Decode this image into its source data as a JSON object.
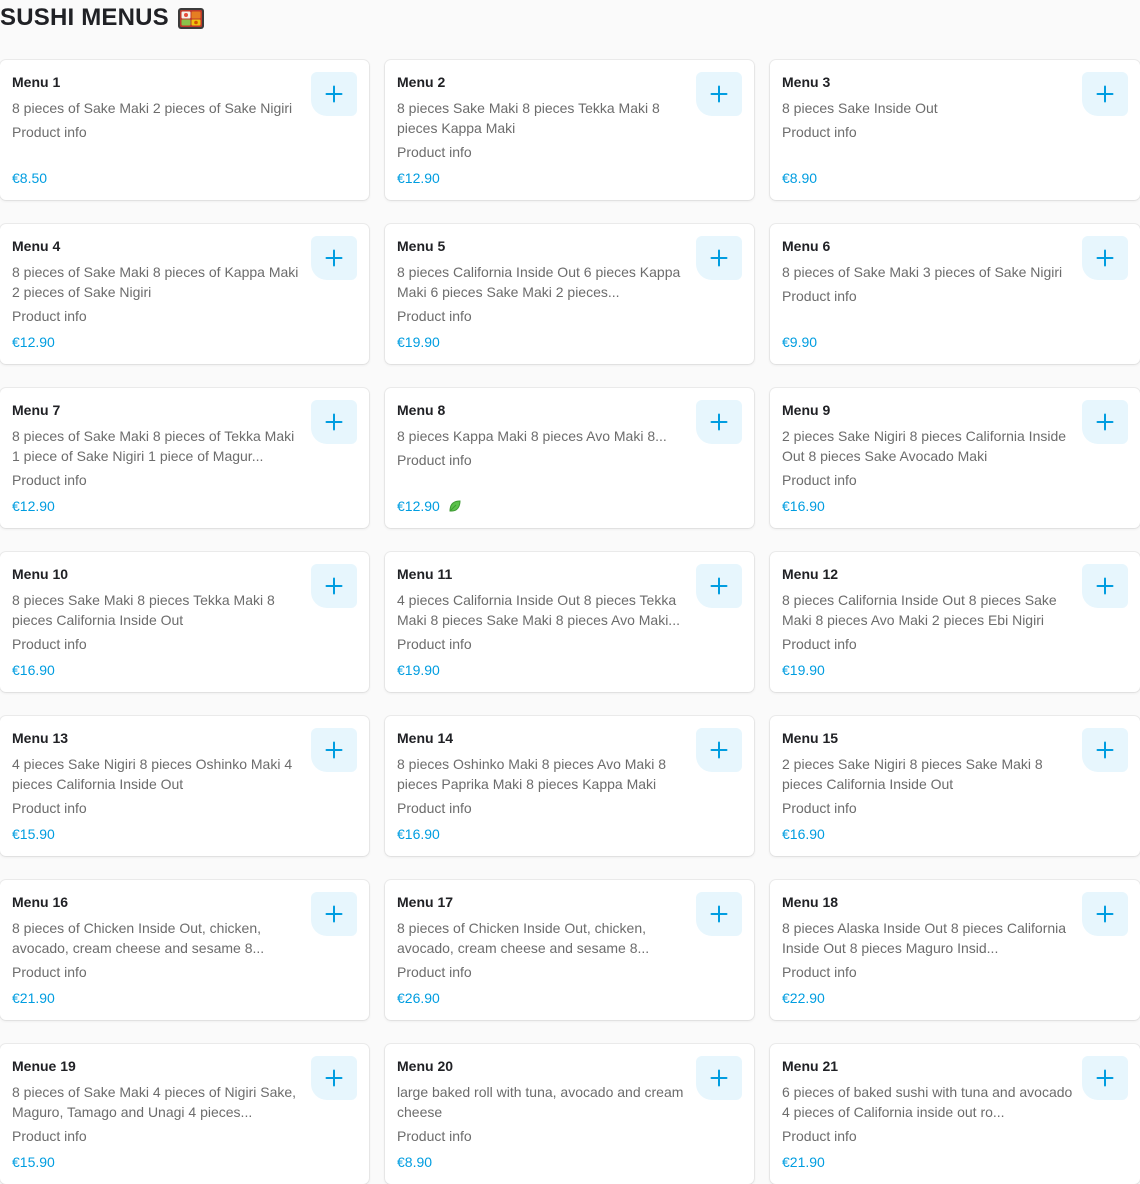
{
  "section": {
    "title": "SUSHI MENUS",
    "title_icon": "bento-box-icon"
  },
  "colors": {
    "accent": "#009de0",
    "add_bg": "#e7f6fd",
    "veg": "#5ac24a"
  },
  "items": [
    {
      "name": "Menu 1",
      "desc": "8 pieces of Sake Maki 2 pieces of Sake Nigiri",
      "info": "Product info",
      "price": "€8.50"
    },
    {
      "name": "Menu 2",
      "desc": "8 pieces Sake Maki 8 pieces Tekka Maki 8 pieces Kappa Maki",
      "info": "Product info",
      "price": "€12.90"
    },
    {
      "name": "Menu 3",
      "desc": "8 pieces Sake Inside Out",
      "info": "Product info",
      "price": "€8.90"
    },
    {
      "name": "Menu 4",
      "desc": "8 pieces of Sake Maki 8 pieces of Kappa Maki 2 pieces of Sake Nigiri",
      "info": "Product info",
      "price": "€12.90"
    },
    {
      "name": "Menu 5",
      "desc": "8 pieces California Inside Out 6 pieces Kappa Maki 6 pieces Sake Maki 2 pieces...",
      "info": "Product info",
      "price": "€19.90"
    },
    {
      "name": "Menu 6",
      "desc": "8 pieces of Sake Maki 3 pieces of Sake Nigiri",
      "info": "Product info",
      "price": "€9.90"
    },
    {
      "name": "Menu 7",
      "desc": "8 pieces of Sake Maki 8 pieces of Tekka Maki 1 piece of Sake Nigiri 1 piece of Magur...",
      "info": "Product info",
      "price": "€12.90"
    },
    {
      "name": "Menu 8",
      "desc": "8 pieces Kappa Maki 8 pieces Avo Maki 8...",
      "info": "Product info",
      "price": "€12.90",
      "vegetarian": true
    },
    {
      "name": "Menu 9",
      "desc": "2 pieces Sake Nigiri 8 pieces California Inside Out 8 pieces Sake Avocado Maki",
      "info": "Product info",
      "price": "€16.90"
    },
    {
      "name": "Menu 10",
      "desc": "8 pieces Sake Maki 8 pieces Tekka Maki 8 pieces California Inside Out",
      "info": "Product info",
      "price": "€16.90"
    },
    {
      "name": "Menu 11",
      "desc": "4 pieces California Inside Out 8 pieces Tekka Maki 8 pieces Sake Maki 8 pieces Avo Maki...",
      "info": "Product info",
      "price": "€19.90"
    },
    {
      "name": "Menu 12",
      "desc": "8 pieces California Inside Out 8 pieces Sake Maki 8 pieces Avo Maki 2 pieces Ebi Nigiri",
      "info": "Product info",
      "price": "€19.90"
    },
    {
      "name": "Menu 13",
      "desc": "4 pieces Sake Nigiri 8 pieces Oshinko Maki 4 pieces California Inside Out",
      "info": "Product info",
      "price": "€15.90"
    },
    {
      "name": "Menu 14",
      "desc": "8 pieces Oshinko Maki 8 pieces Avo Maki 8 pieces Paprika Maki 8 pieces Kappa Maki",
      "info": "Product info",
      "price": "€16.90"
    },
    {
      "name": "Menu 15",
      "desc": "2 pieces Sake Nigiri 8 pieces Sake Maki 8 pieces California Inside Out",
      "info": "Product info",
      "price": "€16.90"
    },
    {
      "name": "Menu 16",
      "desc": "8 pieces of Chicken Inside Out, chicken, avocado, cream cheese and sesame 8...",
      "info": "Product info",
      "price": "€21.90"
    },
    {
      "name": "Menu 17",
      "desc": "8 pieces of Chicken Inside Out, chicken, avocado, cream cheese and sesame 8...",
      "info": "Product info",
      "price": "€26.90"
    },
    {
      "name": "Menu 18",
      "desc": "8 pieces Alaska Inside Out 8 pieces California Inside Out 8 pieces Maguro Insid...",
      "info": "Product info",
      "price": "€22.90"
    },
    {
      "name": "Menue 19",
      "desc": "8 pieces of Sake Maki 4 pieces of Nigiri Sake, Maguro, Tamago and Unagi 4 pieces...",
      "info": "Product info",
      "price": "€15.90"
    },
    {
      "name": "Menu 20",
      "desc": "large baked roll with tuna, avocado and cream cheese",
      "info": "Product info",
      "price": "€8.90"
    },
    {
      "name": "Menu 21",
      "desc": "6 pieces of baked sushi with tuna and avocado 4 pieces of California inside out ro...",
      "info": "Product info",
      "price": "€21.90"
    }
  ]
}
